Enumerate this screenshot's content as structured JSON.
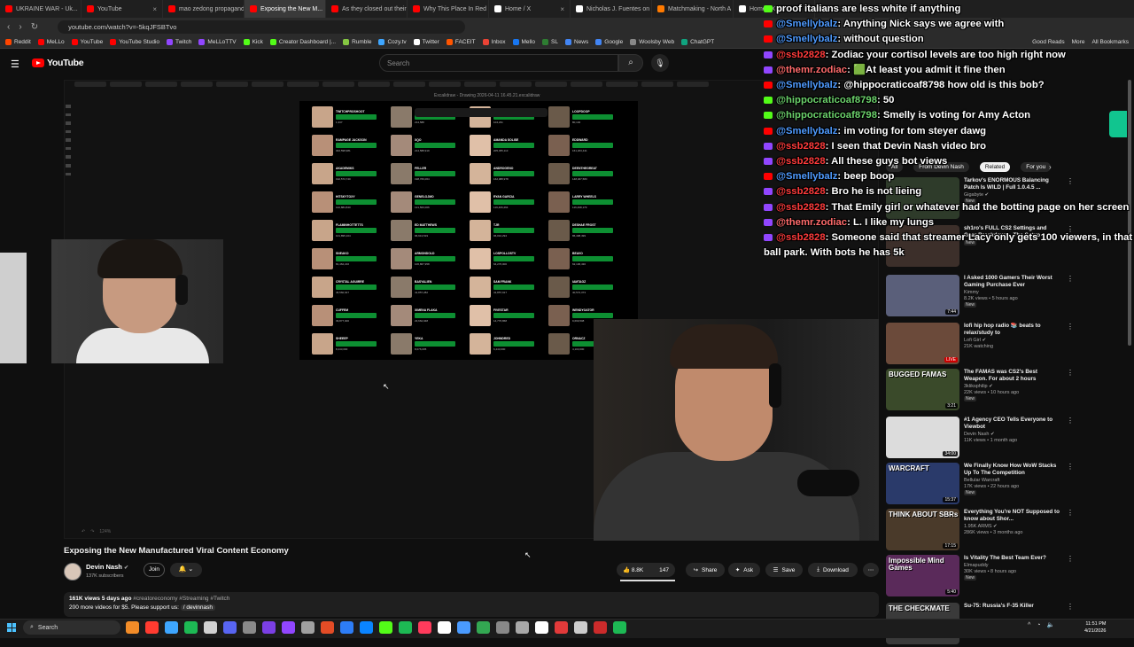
{
  "browser": {
    "tabs": [
      {
        "label": "UKRAINE WAR - Uk...",
        "color": "#ff0000"
      },
      {
        "label": "YouTube",
        "color": "#ff0000"
      },
      {
        "label": "mao zedong propagand...",
        "color": "#ff0000"
      },
      {
        "label": "Exposing the New M...",
        "color": "#ff0000",
        "active": true
      },
      {
        "label": "As they closed out their",
        "color": "#ff0000"
      },
      {
        "label": "Why This Place In Red D",
        "color": "#ff0000"
      },
      {
        "label": "Home / X",
        "color": "#ffffff"
      },
      {
        "label": "Nicholas J. Fuentes on X",
        "color": "#ffffff"
      },
      {
        "label": "Matchmaking - North A",
        "color": "#ff7a00"
      },
      {
        "label": "Home / X",
        "color": "#ffffff"
      }
    ],
    "url": "youtube.com/watch?v=-5kqJFSBTvo",
    "bookmarks": [
      {
        "label": "Reddit",
        "color": "#ff4500"
      },
      {
        "label": "MeLLo",
        "color": "#ff0000"
      },
      {
        "label": "YouTube",
        "color": "#ff0000"
      },
      {
        "label": "YouTube Studio",
        "color": "#ff0000"
      },
      {
        "label": "Twitch",
        "color": "#9146ff"
      },
      {
        "label": "MeLLoTTV",
        "color": "#9146ff"
      },
      {
        "label": "Kick",
        "color": "#53fc18"
      },
      {
        "label": "Creator Dashboard |...",
        "color": "#53fc18"
      },
      {
        "label": "Rumble",
        "color": "#85c742"
      },
      {
        "label": "Cozy.tv",
        "color": "#3ea6ff"
      },
      {
        "label": "Twitter",
        "color": "#ffffff"
      },
      {
        "label": "FACEIT",
        "color": "#ff5500"
      },
      {
        "label": "Inbox",
        "color": "#ea4335"
      },
      {
        "label": "Mello",
        "color": "#1877f2"
      },
      {
        "label": "SL",
        "color": "#2e7d32"
      },
      {
        "label": "News",
        "color": "#4285f4"
      },
      {
        "label": "Google",
        "color": "#4285f4"
      },
      {
        "label": "Woolsby Web",
        "color": "#888888"
      },
      {
        "label": "ChatGPT",
        "color": "#10a37f"
      }
    ],
    "bookmarks_right": [
      "Good Reads",
      "More",
      "All Bookmarks"
    ]
  },
  "youtube": {
    "logo_text": "YouTube",
    "search_placeholder": "Search",
    "icons": {
      "menu": "☰",
      "search": "⌕",
      "mic": "🎙"
    }
  },
  "video": {
    "inner_doc_title": "Excalidraw - Drawing 2026-04-11 16.45.21.excalidraw",
    "zoom_label": "124%",
    "board_cells": [
      {
        "name": "TWITCHPROSHOOT",
        "num": "1,337"
      },
      {
        "name": "XQC",
        "num": "214,588"
      },
      {
        "name": "JYNXZI",
        "num": "104,231"
      },
      {
        "name": "LOOPDOOP",
        "num": "80,102"
      },
      {
        "name": "RAMPAGE JACKSON",
        "num": "302,598,981"
      },
      {
        "name": "XQO",
        "num": "214,588,919"
      },
      {
        "name": "AMANDA SOLISE",
        "num": "205,455,113"
      },
      {
        "name": "EDDWARD",
        "num": "161,203,441"
      },
      {
        "name": "AKADEMIKS",
        "num": "192,573,740"
      },
      {
        "name": "FELLER",
        "num": "198,766,064"
      },
      {
        "name": "ANDROGENO",
        "num": "162,088,978"
      },
      {
        "name": "DEENTHEGREAT",
        "num": "148,467,583"
      },
      {
        "name": "HITSKYTOXY",
        "num": "142,884,840"
      },
      {
        "name": "GENELOJMO",
        "num": "121,500,006"
      },
      {
        "name": "RYAN GARCIA",
        "num": "119,466,264"
      },
      {
        "name": "LARRY WHEELS",
        "num": "116,498,179"
      },
      {
        "name": "FLAMINHOTTETTS",
        "num": "101,895,104"
      },
      {
        "name": "ED MATTHEWS",
        "num": "96,913,519"
      },
      {
        "name": "TJR",
        "num": "96,010,294"
      },
      {
        "name": "DESHAE FROST",
        "num": "86,498,499"
      },
      {
        "name": "SNEAKO",
        "num": "81,462,216"
      },
      {
        "name": "ARMONDOLD",
        "num": "106,867,958"
      },
      {
        "name": "LOSPOLLOSTV",
        "num": "64,276,000"
      },
      {
        "name": "BEAVO",
        "num": "62,106,430"
      },
      {
        "name": "CRYSTAL AGUIRRE",
        "num": "46,560,647"
      },
      {
        "name": "BASYALIEN",
        "num": "41,857,282"
      },
      {
        "name": "SAM FRANK",
        "num": "41,857,917"
      },
      {
        "name": "IAMTAGZ",
        "num": "40,572,373"
      },
      {
        "name": "CUFFEM",
        "num": "39,877,000"
      },
      {
        "name": "XIMENA FLAKA",
        "num": "23,662,948"
      },
      {
        "name": "FIVESTAR",
        "num": "14,776,868"
      },
      {
        "name": "WENDYOATOR",
        "num": "9,699,508"
      },
      {
        "name": "SHEEEP",
        "num": "8,443,000"
      },
      {
        "name": "YEKA",
        "num": "8,076,005"
      },
      {
        "name": "JOHNDRED",
        "num": "6,443,000"
      },
      {
        "name": "ORNACZ",
        "num": "4,103,000"
      }
    ],
    "title": "Exposing the New Manufactured Viral Content Economy",
    "channel": {
      "name": "Devin Nash",
      "subs": "137K subscribers",
      "verified": "✔"
    },
    "buttons": {
      "join": "Join",
      "bell": "🔔 ⌄",
      "likes": "8.8K",
      "dislikes": "147",
      "share": "Share",
      "ask": "Ask",
      "save": "Save",
      "download": "Download",
      "more": "⋯"
    },
    "icons": {
      "like": "👍",
      "share": "↪",
      "ask": "✦",
      "save": "☰",
      "download": "⤓"
    },
    "description": {
      "stats": "161K views  5 days ago",
      "tags": "#creatoreconomy #Streaming #Twitch",
      "line2": "200 more videos for $5. Please support us:",
      "link": "/ devinnash"
    }
  },
  "sidebar": {
    "chips": [
      "All",
      "From Devin Nash",
      "Related",
      "For you"
    ],
    "chips_arrow": "›",
    "items": [
      {
        "title": "Tarkov's ENORMOUS Balancing Patch Is WILD | Full 1.0.4.5 ...",
        "channel": "Gigabyte ✔",
        "views": "",
        "badge": "New",
        "duration": "",
        "thumb": "#2e3b2a",
        "thumb_text": ""
      },
      {
        "title": "sh1ro's FULL CS2 Settings and Gear Breakdown - The Setup",
        "channel": "",
        "views": "",
        "badge": "New",
        "duration": "",
        "thumb": "#3c2f2a",
        "thumb_text": ""
      },
      {
        "title": "I Asked 1000 Gamers Their Worst Gaming Purchase Ever",
        "channel": "Kimmy",
        "views": "8.2K views • 5 hours ago",
        "badge": "New",
        "duration": "7:44",
        "thumb": "#5a5f7a",
        "thumb_text": ""
      },
      {
        "title": "lofi hip hop radio 📚 beats to relax/study to",
        "channel": "Lofi Girl ✔",
        "views": "21K watching",
        "badge": "",
        "duration": "LIVE",
        "thumb": "#6b4a3a",
        "thumb_text": ""
      },
      {
        "title": "The FAMAS was CS2's Best Weapon. For about 2 hours",
        "channel": "3kliksphilip ✔",
        "views": "22K views • 10 hours ago",
        "badge": "New",
        "duration": "3:21",
        "thumb": "#3a4a2a",
        "thumb_text": "BUGGED FAMAS"
      },
      {
        "title": "#1 Agency CEO Tells Everyone to Viewbot",
        "channel": "Devin Nash ✔",
        "views": "11K views • 1 month ago",
        "badge": "",
        "duration": "34:00",
        "thumb": "#dcdcdc",
        "thumb_text": ""
      },
      {
        "title": "We Finally Know How WoW Stacks Up To The Competition",
        "channel": "Bellular Warcraft",
        "views": "17K views • 22 hours ago",
        "badge": "New",
        "duration": "15:37",
        "thumb": "#2a3a6a",
        "thumb_text": "WARCRAFT"
      },
      {
        "title": "Everything You're NOT Supposed to know about Shor...",
        "channel": "1.95K ARMS ✔",
        "views": "286K views • 3 months ago",
        "badge": "",
        "duration": "17:15",
        "thumb": "#4a3a2a",
        "thumb_text": "THINK ABOUT SBRs"
      },
      {
        "title": "Is Vitality The Best Team Ever?",
        "channel": "Elmapuddy",
        "views": "30K views • 8 hours ago",
        "badge": "New",
        "duration": "5:40",
        "thumb": "#5a2a5a",
        "thumb_text": "Impossible Mind Games"
      },
      {
        "title": "Su-75: Russia's F-35 Killer",
        "channel": "",
        "views": "",
        "badge": "",
        "duration": "",
        "thumb": "#3a3a3a",
        "thumb_text": "THE CHECKMATE"
      }
    ]
  },
  "chat": [
    {
      "platform": "kk",
      "user": "",
      "text": "proof italians are less white if anything",
      "color": "#ffffff"
    },
    {
      "platform": "yt",
      "user": "@Smellybalz",
      "text": ": Anything Nick says we agree with",
      "color": "#4f9bff"
    },
    {
      "platform": "yt",
      "user": "@Smellybalz",
      "text": ": without question",
      "color": "#4f9bff"
    },
    {
      "platform": "tw",
      "user": "@ssb2828",
      "text": ": Zodiac your cortisol levels are too high right now",
      "color": "#ff3b3b"
    },
    {
      "platform": "tw",
      "user": "@themr.zodiac",
      "text": ": 🟩At least you admit it fine then",
      "color": "#ff6b6b"
    },
    {
      "platform": "yt",
      "user": "@Smellybalz",
      "text": ": @hippocraticoaf8798 how old is this bob?",
      "color": "#4f9bff"
    },
    {
      "platform": "kk",
      "user": "@hippocraticoaf8798",
      "text": ": 50",
      "color": "#6bd16b"
    },
    {
      "platform": "kk",
      "user": "@hippocraticoaf8798",
      "text": ": Smelly is voting for Amy Acton",
      "color": "#6bd16b"
    },
    {
      "platform": "yt",
      "user": "@Smellybalz",
      "text": ": im voting for tom steyer dawg",
      "color": "#4f9bff"
    },
    {
      "platform": "tw",
      "user": "@ssb2828",
      "text": ": I seen that Devin Nash video bro",
      "color": "#ff3b3b"
    },
    {
      "platform": "tw",
      "user": "@ssb2828",
      "text": ": All these guys bot views",
      "color": "#ff3b3b"
    },
    {
      "platform": "yt",
      "user": "@Smellybalz",
      "text": ": beep boop",
      "color": "#4f9bff"
    },
    {
      "platform": "tw",
      "user": "@ssb2828",
      "text": ": Bro he is not lieing",
      "color": "#ff3b3b"
    },
    {
      "platform": "tw",
      "user": "@ssb2828",
      "text": ": That Emily girl or whatever had the botting page on her screen",
      "color": "#ff3b3b"
    },
    {
      "platform": "tw",
      "user": "@themr.zodiac",
      "text": ": L. I like my lungs",
      "color": "#ff6b6b"
    },
    {
      "platform": "tw",
      "user": "@ssb2828",
      "text": ": Someone said that streamer Lacy only gets 100 viewers, in that ball park. With bots he has 5k",
      "color": "#ff3b3b"
    }
  ],
  "taskbar": {
    "search": "Search",
    "time": "11:51 PM",
    "date": "4/21/2026",
    "apps": [
      "#f28c28",
      "#ff3b30",
      "#3ea6ff",
      "#1db954",
      "#d0d0d0",
      "#5865f2",
      "#8a8a8a",
      "#7b3fe4",
      "#9146ff",
      "#a0a0a0",
      "#e34c26",
      "#2d7df6",
      "#0a84ff",
      "#53fc18",
      "#1db954",
      "#ff3b5c",
      "#ffffff",
      "#4a9bff",
      "#33a852",
      "#888888",
      "#a8a8a8",
      "#ffffff",
      "#e23a3a",
      "#cccccc",
      "#cc2b2b",
      "#1db954"
    ]
  }
}
